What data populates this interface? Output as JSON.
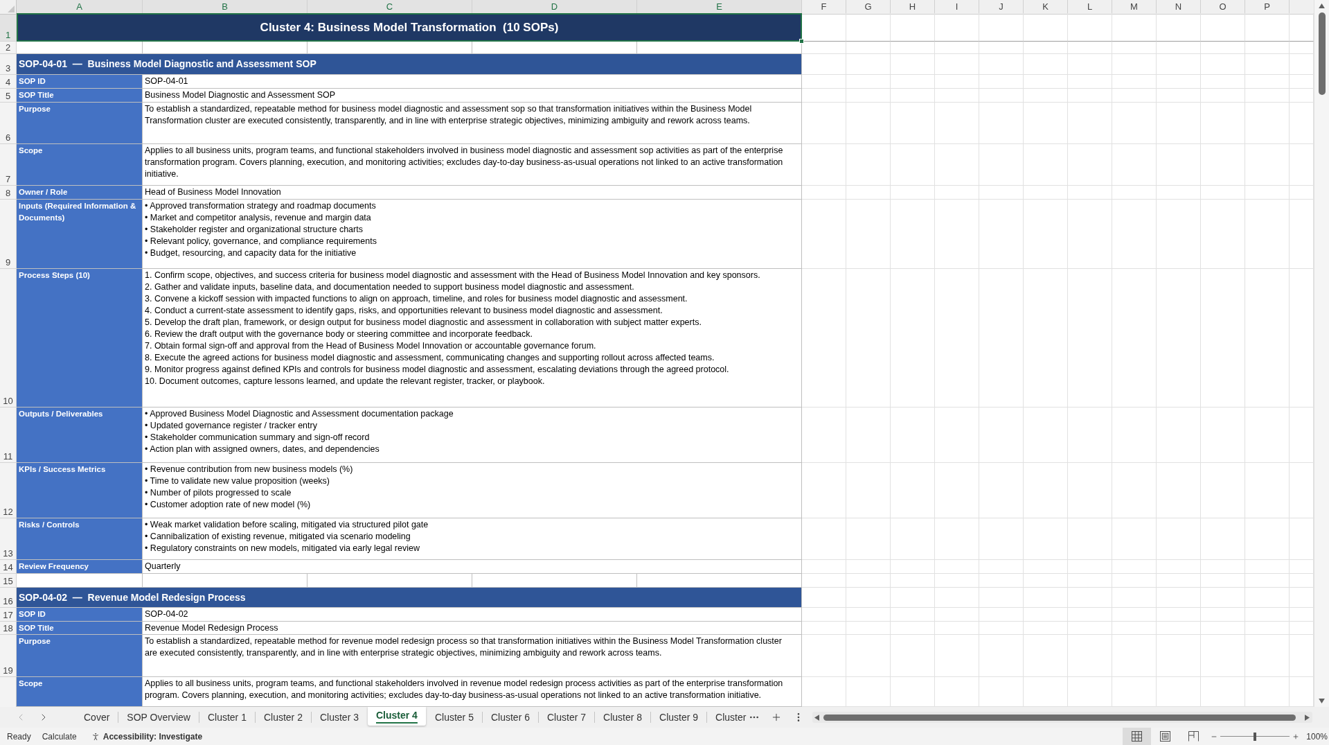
{
  "sheet": {
    "column_headers": [
      {
        "label": "A",
        "selected": true
      },
      {
        "label": "B",
        "selected": true
      },
      {
        "label": "C",
        "selected": true
      },
      {
        "label": "D",
        "selected": true
      },
      {
        "label": "E",
        "selected": true
      },
      {
        "label": "F",
        "selected": false
      },
      {
        "label": "G",
        "selected": false
      },
      {
        "label": "H",
        "selected": false
      },
      {
        "label": "I",
        "selected": false
      },
      {
        "label": "J",
        "selected": false
      },
      {
        "label": "K",
        "selected": false
      },
      {
        "label": "L",
        "selected": false
      },
      {
        "label": "M",
        "selected": false
      },
      {
        "label": "N",
        "selected": false
      },
      {
        "label": "O",
        "selected": false
      },
      {
        "label": "P",
        "selected": false
      }
    ],
    "rows": [
      {
        "row_header": {
          "label": "1",
          "selected": true
        },
        "kind": "title",
        "text": "Cluster 4: Business Model Transformation  (10 SOPs)",
        "cell_selected": true
      },
      {
        "row_header": {
          "label": "2",
          "selected": false
        },
        "kind": "blank"
      },
      {
        "row_header": {
          "label": "3",
          "selected": false
        },
        "kind": "section",
        "text": "SOP-04-01  —  Business Model Diagnostic and Assessment SOP"
      },
      {
        "row_header": {
          "label": "4",
          "selected": false
        },
        "kind": "field",
        "label": "SOP ID",
        "value": "SOP-04-01"
      },
      {
        "row_header": {
          "label": "5",
          "selected": false
        },
        "kind": "field",
        "label": "SOP Title",
        "value": "Business Model Diagnostic and Assessment SOP"
      },
      {
        "row_header": {
          "label": "6",
          "selected": false
        },
        "kind": "field",
        "label": "Purpose",
        "value": "To establish a standardized, repeatable method for business model diagnostic and assessment sop so that transformation initiatives within the Business Model Transformation cluster are executed consistently, transparently, and in line with enterprise strategic objectives, minimizing ambiguity and rework across teams."
      },
      {
        "row_header": {
          "label": "7",
          "selected": false
        },
        "kind": "field",
        "label": "Scope",
        "value": "Applies to all business units, program teams, and functional stakeholders involved in business model diagnostic and assessment sop activities as part of the enterprise transformation program. Covers planning, execution, and monitoring activities; excludes day-to-day business-as-usual operations not linked to an active transformation initiative."
      },
      {
        "row_header": {
          "label": "8",
          "selected": false
        },
        "kind": "field",
        "label": "Owner / Role",
        "value": "Head of Business Model Innovation"
      },
      {
        "row_header": {
          "label": "9",
          "selected": false
        },
        "kind": "list",
        "label": "Inputs (Required Information & Documents)",
        "lines": [
          "• Approved transformation strategy and roadmap documents",
          "• Market and competitor analysis, revenue and margin data",
          "• Stakeholder register and organizational structure charts",
          "• Relevant policy, governance, and compliance requirements",
          "• Budget, resourcing, and capacity data for the initiative"
        ]
      },
      {
        "row_header": {
          "label": "10",
          "selected": false
        },
        "kind": "list",
        "label": "Process Steps (10)",
        "lines": [
          "1. Confirm scope, objectives, and success criteria for business model diagnostic and assessment with the Head of Business Model Innovation and key sponsors.",
          "2. Gather and validate inputs, baseline data, and documentation needed to support business model diagnostic and assessment.",
          "3. Convene a kickoff session with impacted functions to align on approach, timeline, and roles for business model diagnostic and assessment.",
          "4. Conduct a current-state assessment to identify gaps, risks, and opportunities relevant to business model diagnostic and assessment.",
          "5. Develop the draft plan, framework, or design output for business model diagnostic and assessment in collaboration with subject matter experts.",
          "6. Review the draft output with the governance body or steering committee and incorporate feedback.",
          "7. Obtain formal sign-off and approval from the Head of Business Model Innovation or accountable governance forum.",
          "8. Execute the agreed actions for business model diagnostic and assessment, communicating changes and supporting rollout across affected teams.",
          "9. Monitor progress against defined KPIs and controls for business model diagnostic and assessment, escalating deviations through the agreed protocol.",
          "10. Document outcomes, capture lessons learned, and update the relevant register, tracker, or playbook."
        ]
      },
      {
        "row_header": {
          "label": "11",
          "selected": false
        },
        "kind": "list",
        "label": "Outputs / Deliverables",
        "lines": [
          "• Approved Business Model Diagnostic and Assessment documentation package",
          "• Updated governance register / tracker entry",
          "• Stakeholder communication summary and sign-off record",
          "• Action plan with assigned owners, dates, and dependencies"
        ]
      },
      {
        "row_header": {
          "label": "12",
          "selected": false
        },
        "kind": "list",
        "label": "KPIs / Success Metrics",
        "lines": [
          "• Revenue contribution from new business models (%)",
          "• Time to validate new value proposition (weeks)",
          "• Number of pilots progressed to scale",
          "• Customer adoption rate of new model (%)"
        ]
      },
      {
        "row_header": {
          "label": "13",
          "selected": false
        },
        "kind": "list",
        "label": "Risks / Controls",
        "lines": [
          "• Weak market validation before scaling, mitigated via structured pilot gate",
          "• Cannibalization of existing revenue, mitigated via scenario modeling",
          "• Regulatory constraints on new models, mitigated via early legal review"
        ]
      },
      {
        "row_header": {
          "label": "14",
          "selected": false
        },
        "kind": "field",
        "label": "Review Frequency",
        "value": "Quarterly"
      },
      {
        "row_header": {
          "label": "15",
          "selected": false
        },
        "kind": "blank"
      },
      {
        "row_header": {
          "label": "16",
          "selected": false
        },
        "kind": "section",
        "text": "SOP-04-02  —  Revenue Model Redesign Process"
      },
      {
        "row_header": {
          "label": "17",
          "selected": false
        },
        "kind": "field",
        "label": "SOP ID",
        "value": "SOP-04-02"
      },
      {
        "row_header": {
          "label": "18",
          "selected": false
        },
        "kind": "field",
        "label": "SOP Title",
        "value": "Revenue Model Redesign Process"
      },
      {
        "row_header": {
          "label": "19",
          "selected": false
        },
        "kind": "field",
        "label": "Purpose",
        "value": "To establish a standardized, repeatable method for revenue model redesign process so that transformation initiatives within the Business Model Transformation cluster are executed consistently, transparently, and in line with enterprise strategic objectives, minimizing ambiguity and rework across teams."
      },
      {
        "kind": "field",
        "label": "Scope",
        "value": "Applies to all business units, program teams, and functional stakeholders involved in revenue model redesign process activities as part of the enterprise transformation program. Covers planning, execution, and monitoring activities; excludes day-to-day business-as-usual operations not linked to an active transformation initiative."
      }
    ]
  },
  "tab_nav": [
    {
      "kind": "prev",
      "disabled": true
    },
    {
      "kind": "next",
      "disabled": false
    }
  ],
  "sheet_tabs": [
    {
      "label": "Cover",
      "selected": false
    },
    {
      "label": "SOP Overview",
      "selected": false
    },
    {
      "label": "Cluster 1",
      "selected": false
    },
    {
      "label": "Cluster 2",
      "selected": false
    },
    {
      "label": "Cluster 3",
      "selected": false
    },
    {
      "label": "Cluster 4",
      "selected": true
    },
    {
      "label": "Cluster 5",
      "selected": false
    },
    {
      "label": "Cluster 6",
      "selected": false
    },
    {
      "label": "Cluster 7",
      "selected": false
    },
    {
      "label": "Cluster 8",
      "selected": false
    },
    {
      "label": "Cluster 9",
      "selected": false
    },
    {
      "label": "Cluster",
      "selected": false
    }
  ],
  "status_bar": {
    "mode": "Ready",
    "calculate": "Calculate",
    "accessibility": "Accessibility: Investigate",
    "views": [
      {
        "kind": "normal",
        "selected": true
      },
      {
        "kind": "page_layout",
        "selected": false
      },
      {
        "kind": "page_break",
        "selected": false
      }
    ],
    "zoom": {
      "level": 0.5,
      "label": "100%"
    }
  }
}
